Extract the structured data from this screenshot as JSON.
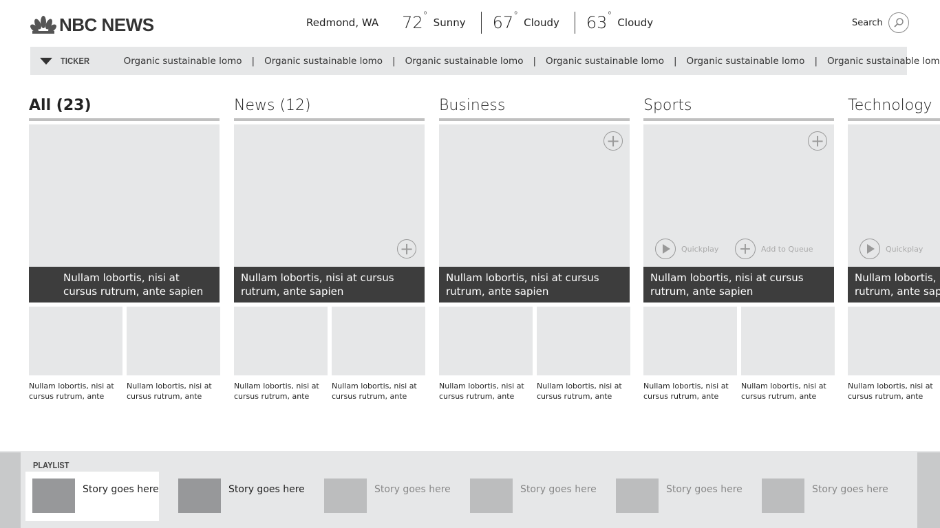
{
  "header": {
    "logo_text": "NBC NEWS",
    "weather": {
      "location": "Redmond, WA",
      "forecast": [
        {
          "temp": "72",
          "condition": "Sunny"
        },
        {
          "temp": "67",
          "condition": "Cloudy"
        },
        {
          "temp": "63",
          "condition": "Cloudy"
        }
      ]
    },
    "search_label": "Search"
  },
  "ticker": {
    "label": "TICKER",
    "items": [
      "Organic sustainable lomo",
      "Organic sustainable lomo",
      "Organic sustainable lomo",
      "Organic sustainable lomo",
      "Organic sustainable lomo",
      "Organic sustainable lomo"
    ],
    "separator": "|"
  },
  "columns": [
    {
      "title": "All (23)",
      "hero_caption": "Nullam lobortis, nisi at cursus rutrum, ante sapien",
      "thumbs": [
        "Nullam lobortis, nisi at cursus rutrum, ante",
        "Nullam lobortis, nisi at cursus rutrum, ante"
      ]
    },
    {
      "title": "News (12)",
      "hero_caption": "Nullam lobortis, nisi at cursus rutrum, ante sapien",
      "thumbs": [
        "Nullam lobortis, nisi at cursus rutrum, ante",
        "Nullam lobortis, nisi at cursus rutrum, ante"
      ]
    },
    {
      "title": "Business",
      "hero_caption": "Nullam lobortis, nisi at cursus rutrum, ante sapien",
      "thumbs": [
        "Nullam lobortis, nisi at cursus rutrum, ante",
        "Nullam lobortis, nisi at cursus rutrum, ante"
      ]
    },
    {
      "title": "Sports",
      "hero_caption": "Nullam lobortis, nisi at cursus rutrum, ante sapien",
      "thumbs": [
        "Nullam lobortis, nisi at cursus rutrum, ante",
        "Nullam lobortis, nisi at cursus rutrum, ante"
      ],
      "quickplay": "Quickplay",
      "add_to_queue": "Add to Queue"
    },
    {
      "title": "Technology",
      "hero_caption": "Nullam lobortis, nisi at cursus rutrum, ante sapien",
      "thumbs": [
        "Nullam lobortis, nisi at cursus rutrum, ante"
      ],
      "quickplay": "Quickplay"
    }
  ],
  "playlist": {
    "label": "PLAYLIST",
    "items": [
      {
        "text": "Story goes here",
        "state": "selected"
      },
      {
        "text": "Story goes here",
        "state": "active"
      },
      {
        "text": "Story goes here",
        "state": "inactive"
      },
      {
        "text": "Story goes here",
        "state": "inactive"
      },
      {
        "text": "Story goes here",
        "state": "inactive"
      },
      {
        "text": "Story goes here",
        "state": "inactive"
      }
    ]
  },
  "colors": {
    "tile_bg": "#e6e7e8",
    "caption_bg": "#3d3d3d",
    "thumb_active": "#97989a",
    "thumb_inactive": "#bcbdbe"
  }
}
